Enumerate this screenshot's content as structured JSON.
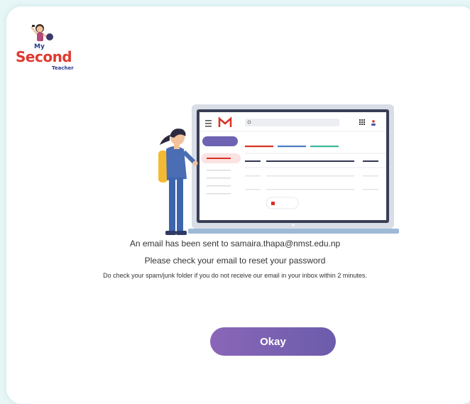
{
  "logo": {
    "line1": "My",
    "line2": "Second",
    "line3": "Teacher"
  },
  "message": {
    "line1_prefix": "An email has been sent to ",
    "email": "samaira.thapa@nmst.edu.np",
    "line2": "Please check your email to reset your password",
    "line3": "Do check your spam/junk folder if you do not receive our email in your inbox within 2 minutes."
  },
  "okay_button": {
    "label": "Okay"
  },
  "colors": {
    "accent": "#7a60b3",
    "background": "#e7f6f6",
    "logo_red": "#e03a2f",
    "logo_blue": "#2a3c8e"
  }
}
